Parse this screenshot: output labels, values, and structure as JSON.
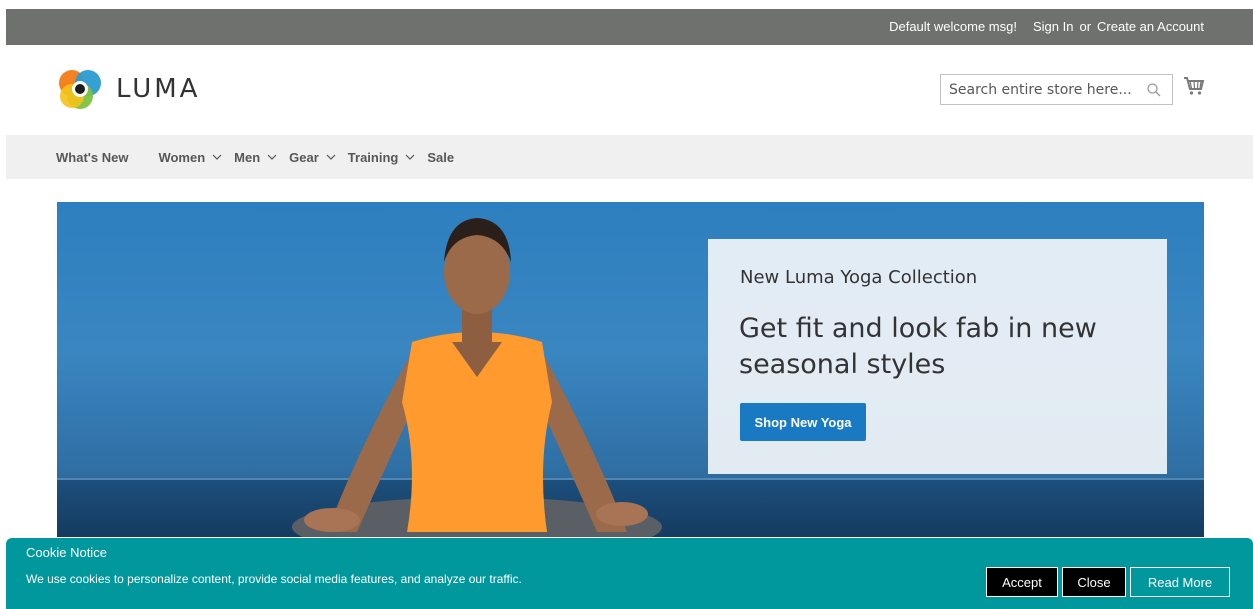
{
  "topbar": {
    "welcome": "Default welcome msg!",
    "sign_in": "Sign In",
    "or": "or",
    "create_account": "Create an Account"
  },
  "header": {
    "logo_text": "LUMA",
    "search_placeholder": "Search entire store here...",
    "search_icon": "search-icon",
    "cart_icon": "cart-icon"
  },
  "nav": {
    "items": [
      {
        "label": "What's New",
        "has_dropdown": false
      },
      {
        "label": "Women",
        "has_dropdown": true
      },
      {
        "label": "Men",
        "has_dropdown": true
      },
      {
        "label": "Gear",
        "has_dropdown": true
      },
      {
        "label": "Training",
        "has_dropdown": true
      },
      {
        "label": "Sale",
        "has_dropdown": false
      }
    ]
  },
  "hero": {
    "kicker": "New Luma Yoga Collection",
    "headline": "Get fit and look fab in new seasonal styles",
    "cta": "Shop New Yoga"
  },
  "cookie": {
    "title": "Cookie Notice",
    "message": "We use cookies to personalize content, provide social media features, and analyze our traffic.",
    "accept": "Accept",
    "close": "Close",
    "read_more": "Read More"
  },
  "colors": {
    "topbar": "#6e716e",
    "nav_bg": "#f0f0f0",
    "primary_button": "#1979c3",
    "cookie_bg": "#00989d"
  }
}
